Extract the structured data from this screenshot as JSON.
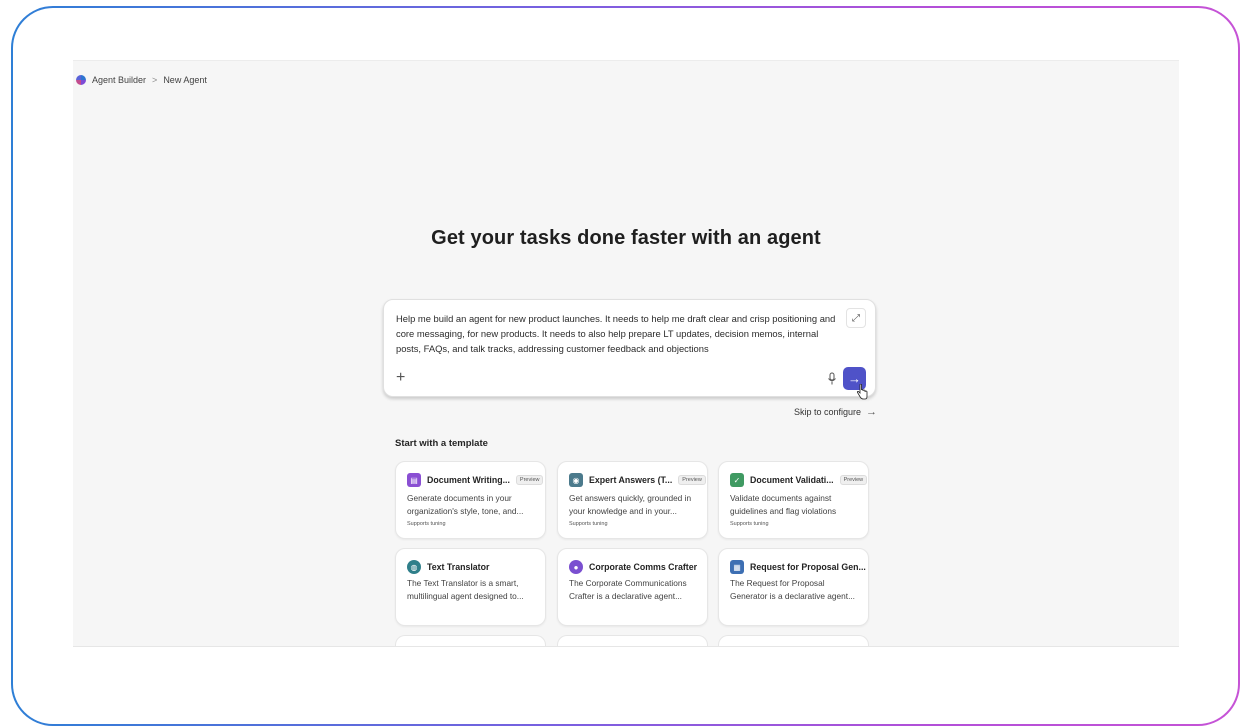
{
  "breadcrumb": {
    "root": "Agent Builder",
    "separator": ">",
    "current": "New Agent"
  },
  "headline": "Get your tasks done faster with an agent",
  "composer": {
    "text": "Help me build an agent for new product launches. It needs to help me draft clear and crisp positioning and core messaging, for new products. It needs to also help prepare LT updates, decision memos, internal posts, FAQs, and talk tracks, addressing customer feedback and objections",
    "add_glyph": "+",
    "send_glyph": "→",
    "expand_glyph": "⤢"
  },
  "skip": {
    "label": "Skip to configure",
    "arrow": "→"
  },
  "templates": {
    "heading": "Start with a template",
    "cards": [
      {
        "title": "Document Writing...",
        "badge": "Preview",
        "desc": "Generate documents in your organization's style, tone, and...",
        "foot": "Supports tuning",
        "icon": "document-icon",
        "icon_color": "#8a4fd3"
      },
      {
        "title": "Expert Answers (T...",
        "badge": "Preview",
        "desc": "Get answers quickly, grounded in your knowledge and in your...",
        "foot": "Supports tuning",
        "icon": "expert-icon",
        "icon_color": "#4b7a8c"
      },
      {
        "title": "Document Validati...",
        "badge": "Preview",
        "desc": "Validate documents against guidelines and flag violations",
        "foot": "Supports tuning",
        "icon": "check-icon",
        "icon_color": "#3f9a62"
      },
      {
        "title": "Text Translator",
        "badge": "",
        "desc": "The Text Translator is a smart, multilingual agent designed to...",
        "foot": "",
        "icon": "globe-icon",
        "icon_color": "#2f7f8a"
      },
      {
        "title": "Corporate Comms Crafter",
        "badge": "",
        "desc": "The Corporate Communications Crafter is a declarative agent...",
        "foot": "",
        "icon": "person-icon",
        "icon_color": "#7a4fd0"
      },
      {
        "title": "Request for Proposal Gen...",
        "badge": "",
        "desc": "The Request for Proposal Generator is a declarative agent...",
        "foot": "",
        "icon": "proposal-icon",
        "icon_color": "#3d6fb3"
      }
    ]
  }
}
